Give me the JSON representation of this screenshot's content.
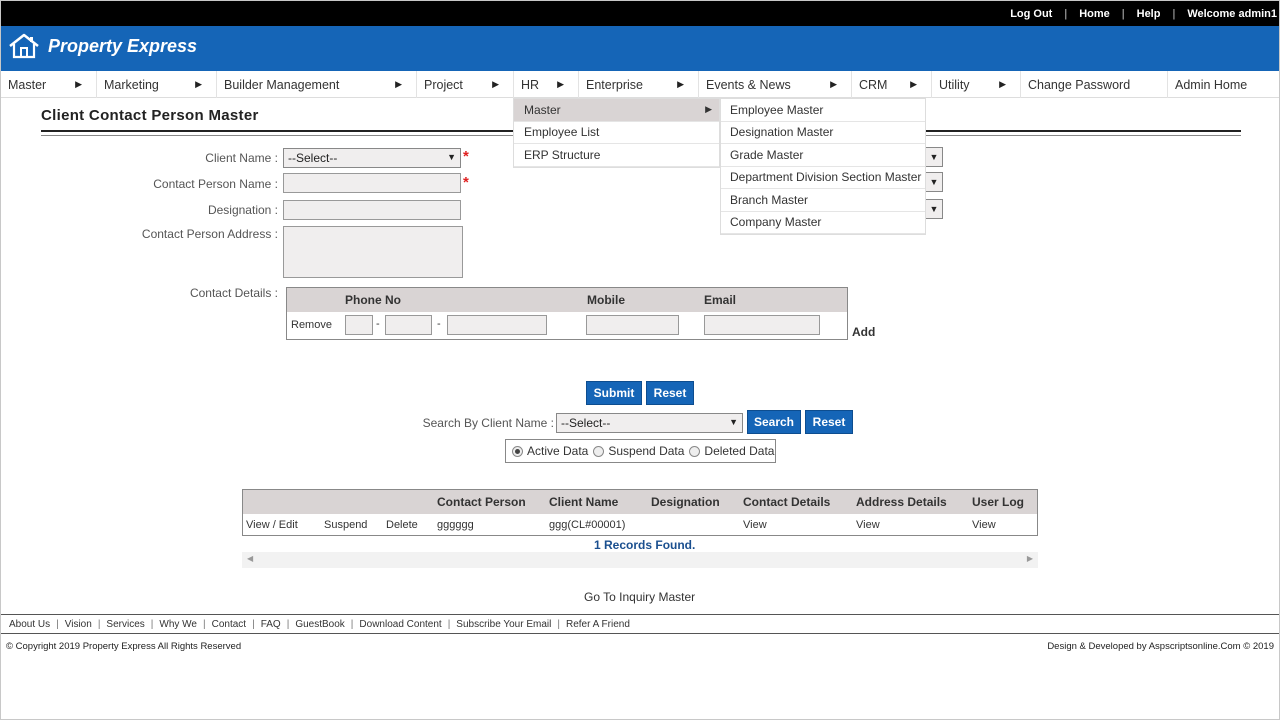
{
  "topbar": {
    "logout": "Log Out",
    "home": "Home",
    "help": "Help",
    "welcome": "Welcome admin1"
  },
  "brand": {
    "name": "Property Express",
    "icon": "house-icon",
    "color": "#1565b7"
  },
  "menu": [
    {
      "label": "Master",
      "has_arrow": true
    },
    {
      "label": "Marketing",
      "has_arrow": true
    },
    {
      "label": "Builder Management",
      "has_arrow": true
    },
    {
      "label": "Project",
      "has_arrow": true
    },
    {
      "label": "HR",
      "has_arrow": true
    },
    {
      "label": "Enterprise",
      "has_arrow": true
    },
    {
      "label": "Events & News",
      "has_arrow": true
    },
    {
      "label": "CRM",
      "has_arrow": true
    },
    {
      "label": "Utility",
      "has_arrow": true
    },
    {
      "label": "Change Password",
      "has_arrow": false
    },
    {
      "label": "Admin Home",
      "has_arrow": false
    }
  ],
  "hr_menu": {
    "items": [
      "Master",
      "Employee List",
      "ERP Structure"
    ],
    "active": "Master",
    "submenu": [
      "Employee Master",
      "Designation Master",
      "Grade Master",
      "Department Division Section Master",
      "Branch Master",
      "Company Master"
    ]
  },
  "page": {
    "title": "Client Contact Person Master"
  },
  "form": {
    "client_name_label": "Client Name :",
    "client_name_value": "--Select--",
    "contact_person_label": "Contact Person Name :",
    "designation_label": "Designation :",
    "address_label": "Contact Person Address :",
    "contact_details_label": "Contact Details :",
    "required_mark": "*"
  },
  "contact_table": {
    "headers": [
      "Phone No",
      "Mobile",
      "Email"
    ],
    "remove": "Remove",
    "dash": "-",
    "add": "Add"
  },
  "buttons": {
    "submit": "Submit",
    "reset": "Reset",
    "search": "Search",
    "search_reset": "Reset"
  },
  "search": {
    "label": "Search By Client Name :",
    "value": "--Select--"
  },
  "filters": {
    "options": [
      "Active Data",
      "Suspend Data",
      "Deleted Data"
    ],
    "selected": "Active Data"
  },
  "grid": {
    "headers": [
      "Contact Person",
      "Client Name",
      "Designation",
      "Contact Details",
      "Address Details",
      "User Log"
    ],
    "rows": [
      {
        "view_edit": "View / Edit",
        "suspend": "Suspend",
        "delete": "Delete",
        "contact_person": "gggggg",
        "client_name": "ggg(CL#00001)",
        "designation": "",
        "contact_details": "View",
        "address_details": "View",
        "user_log": "View"
      }
    ],
    "records_found": "1 Records Found."
  },
  "goto_link": "Go To Inquiry Master",
  "footer": {
    "links": [
      "About Us",
      "Vision",
      "Services",
      "Why We",
      "Contact",
      "FAQ",
      "GuestBook",
      "Download Content",
      "Subscribe Your Email",
      "Refer A Friend"
    ],
    "copyright": "© Copyright 2019 Property Express All Rights Reserved",
    "credit": "Design & Developed by Aspscriptsonline.Com © 2019"
  }
}
